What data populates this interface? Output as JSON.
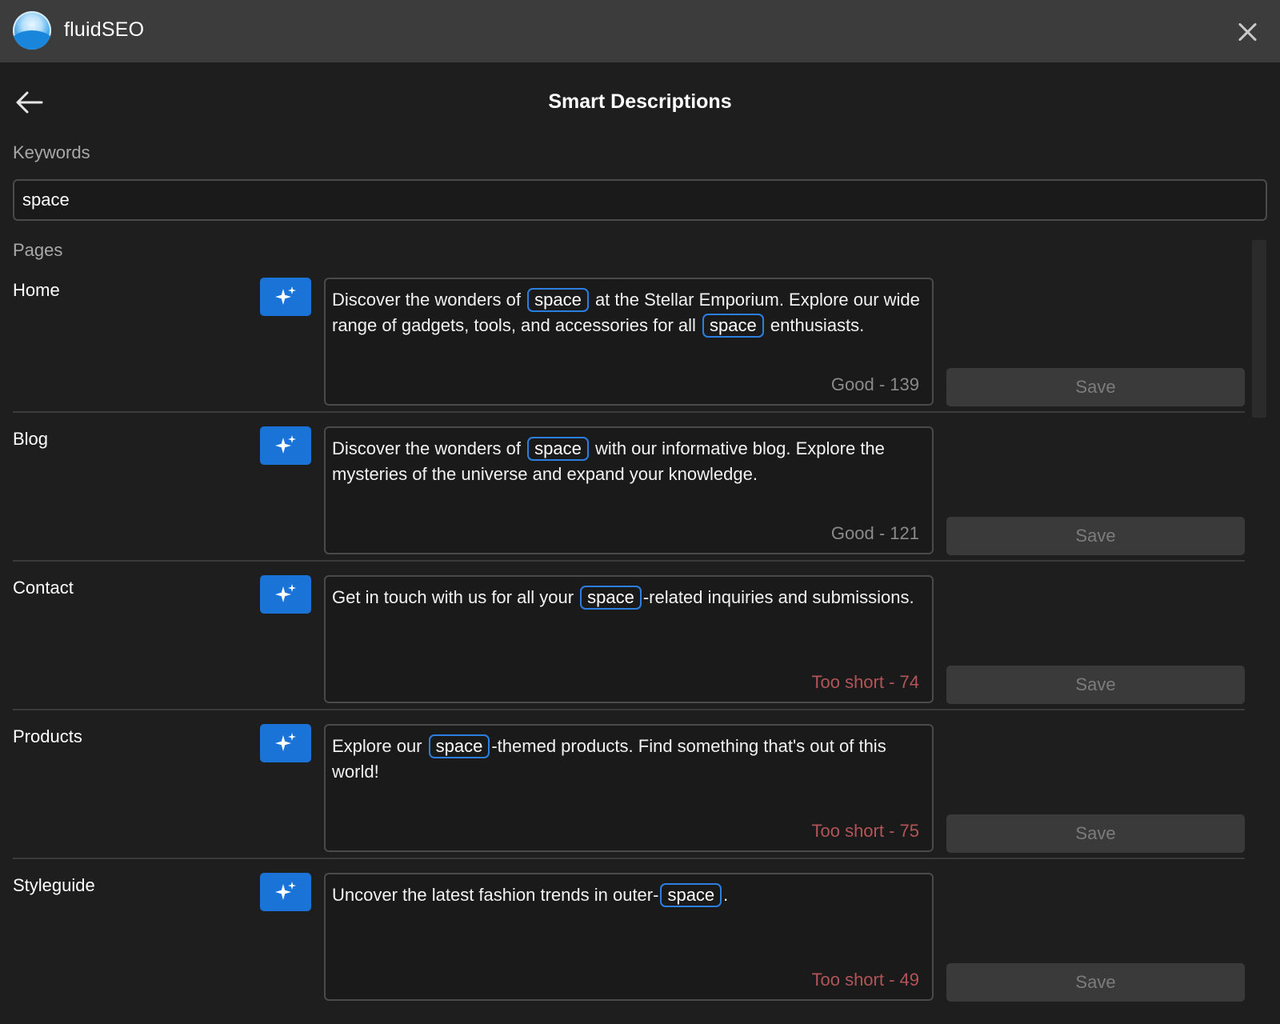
{
  "app": {
    "title": "fluidSEO",
    "logo_icon": "fluidseo-logo",
    "close_icon": "close-icon"
  },
  "header": {
    "title": "Smart Descriptions",
    "back_icon": "arrow-left-icon"
  },
  "keywords": {
    "label": "Keywords",
    "value": "space"
  },
  "pages_label": "Pages",
  "colors": {
    "accent": "#1a73d6",
    "keyword_border": "#2b7fe0",
    "good_status": "#8a8a8a",
    "short_status": "#b25458",
    "background": "#1e1e1e",
    "titlebar": "#3c3c3c"
  },
  "save_label": "Save",
  "pages": [
    {
      "name": "Home",
      "segments": [
        {
          "text": "Discover the wonders of "
        },
        {
          "text": "space",
          "keyword": true
        },
        {
          "text": " at the Stellar Emporium. Explore our wide range of gadgets, tools, and accessories for all "
        },
        {
          "text": "space",
          "keyword": true
        },
        {
          "text": " enthusiasts."
        }
      ],
      "status": "Good - 139",
      "status_type": "good"
    },
    {
      "name": "Blog",
      "segments": [
        {
          "text": "Discover the wonders of "
        },
        {
          "text": "space",
          "keyword": true
        },
        {
          "text": " with our informative blog. Explore the mysteries of the universe and expand your knowledge."
        }
      ],
      "status": "Good - 121",
      "status_type": "good"
    },
    {
      "name": "Contact",
      "segments": [
        {
          "text": "Get in touch with us for all your "
        },
        {
          "text": "space",
          "keyword": true
        },
        {
          "text": "-related inquiries and submissions."
        }
      ],
      "status": "Too short - 74",
      "status_type": "short"
    },
    {
      "name": "Products",
      "segments": [
        {
          "text": "Explore our "
        },
        {
          "text": "space",
          "keyword": true
        },
        {
          "text": "-themed products. Find something that's out of this world!"
        }
      ],
      "status": "Too short - 75",
      "status_type": "short"
    },
    {
      "name": "Styleguide",
      "segments": [
        {
          "text": "Uncover the latest fashion trends in outer-"
        },
        {
          "text": "space",
          "keyword": true
        },
        {
          "text": "."
        }
      ],
      "status": "Too short - 49",
      "status_type": "short"
    }
  ]
}
